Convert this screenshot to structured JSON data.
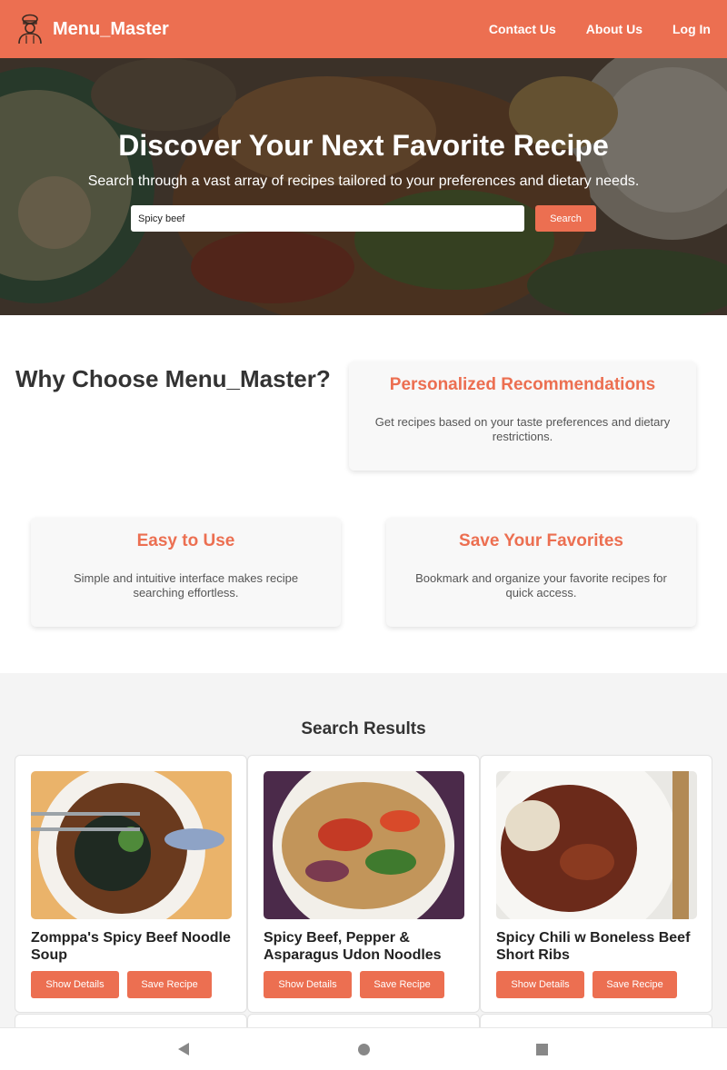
{
  "header": {
    "brand": "Menu_Master",
    "nav": [
      "Contact Us",
      "About Us",
      "Log In"
    ]
  },
  "hero": {
    "title": "Discover Your Next Favorite Recipe",
    "subtitle": "Search through a vast array of recipes tailored to your preferences and dietary needs.",
    "search_value": "Spicy beef",
    "search_button": "Search"
  },
  "why": {
    "title": "Why Choose Menu_Master?",
    "features": [
      {
        "title": "Personalized Recommendations",
        "text": "Get recipes based on your taste preferences and dietary restrictions."
      },
      {
        "title": "Easy to Use",
        "text": "Simple and intuitive interface makes recipe searching effortless."
      },
      {
        "title": "Save Your Favorites",
        "text": "Bookmark and organize your favorite recipes for quick access."
      }
    ]
  },
  "results": {
    "title": "Search Results",
    "items": [
      {
        "title": "Zomppa's Spicy Beef Noodle Soup",
        "details_label": "Show Details",
        "save_label": "Save Recipe"
      },
      {
        "title": "Spicy Beef, Pepper & Asparagus Udon Noodles",
        "details_label": "Show Details",
        "save_label": "Save Recipe"
      },
      {
        "title": "Spicy Chili w Boneless Beef Short Ribs",
        "details_label": "Show Details",
        "save_label": "Save Recipe"
      }
    ]
  },
  "colors": {
    "accent": "#ec6f51",
    "section_bg": "#f4f4f4",
    "card_bg": "#f8f8f8"
  }
}
